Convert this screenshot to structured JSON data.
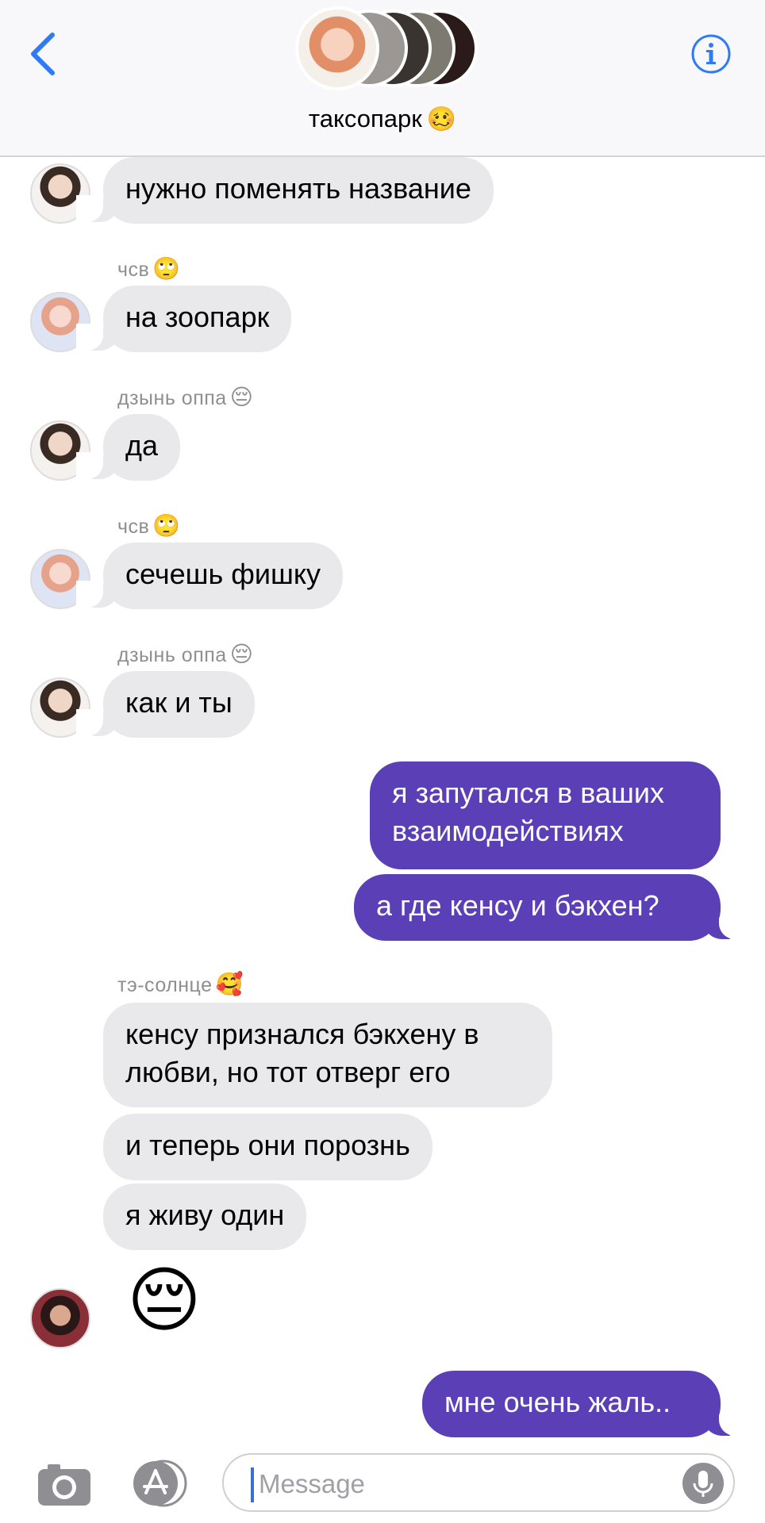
{
  "header": {
    "title": "таксопарк",
    "title_emoji": "🥴",
    "back_icon": "chevron-left-icon",
    "info_icon": "info-circle-icon"
  },
  "messages": [
    {
      "side": "in",
      "text": "нужно поменять название"
    },
    {
      "side": "in",
      "sender": "чсв",
      "sender_emoji": "🙄",
      "text": "на зоопарк"
    },
    {
      "side": "in",
      "sender": "дзынь оппа",
      "sender_emoji": "😔",
      "text": "да"
    },
    {
      "side": "in",
      "sender": "чсв",
      "sender_emoji": "🙄",
      "text": "сечешь фишку"
    },
    {
      "side": "in",
      "sender": "дзынь оппа",
      "sender_emoji": "😔",
      "text": "как и ты"
    },
    {
      "side": "out",
      "text": "я запутался в ваших взаимодействиях"
    },
    {
      "side": "out",
      "text": "а где кенсу и бэкхен?"
    },
    {
      "side": "in",
      "sender": "тэ-солнце",
      "sender_emoji": "🥰",
      "text": "кенсу признался бэкхену в любви, но тот отверг его"
    },
    {
      "side": "in",
      "text": "и теперь они порознь"
    },
    {
      "side": "in",
      "text": "я живу один"
    },
    {
      "side": "in",
      "text": "😔"
    },
    {
      "side": "out",
      "text": "мне очень жаль.."
    }
  ],
  "composer": {
    "placeholder": "Message",
    "camera_icon": "camera-icon",
    "apps_icon": "app-store-icon",
    "mic_icon": "microphone-icon"
  },
  "colors": {
    "outgoing_bubble": "#5b3fb6",
    "incoming_bubble": "#e9e9eb",
    "accent": "#2f7bf5"
  }
}
